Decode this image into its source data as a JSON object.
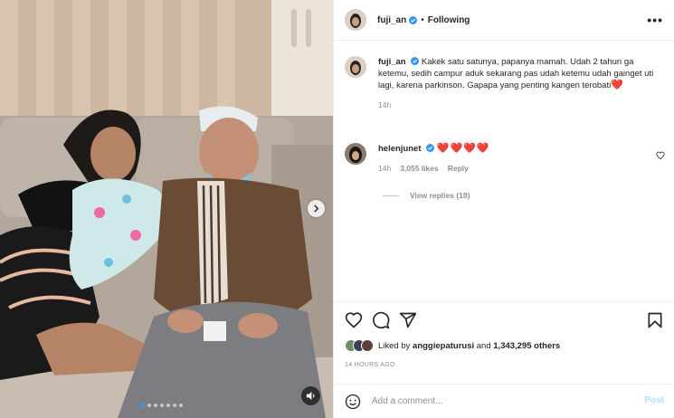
{
  "post": {
    "author": "fuji_an",
    "follow_status": "Following",
    "more_icon": "more-horizontal-icon",
    "caption": {
      "username": "fuji_an",
      "text": "Kakek satu satunya, papanya mamah. Udah 2 tahun ga ketemu, sedih campur aduk sekarang pas udah ketemu udah gainget uti lagi, karena parkinson. Gapapa yang penting kangen terobati",
      "emoji": "❤️",
      "time": "14h"
    },
    "comments": [
      {
        "username": "helenjunet",
        "text": "❤️❤️❤️❤️",
        "time": "14h",
        "likes": "3,055 likes",
        "reply_label": "Reply",
        "view_replies": "View replies (18)"
      }
    ],
    "liked_by": {
      "prefix": "Liked by",
      "user": "anggiepaturusi",
      "and": "and",
      "others": "1,343,295 others"
    },
    "timestamp": "14 HOURS AGO",
    "comment_box": {
      "placeholder": "Add a comment...",
      "post_label": "Post"
    },
    "carousel": {
      "count": 7,
      "active": 0
    },
    "colors": {
      "verified": "#3897f0",
      "heart": "#ed4956",
      "post_button": "#b2dffc",
      "muted_text": "#8e8e8e"
    }
  }
}
